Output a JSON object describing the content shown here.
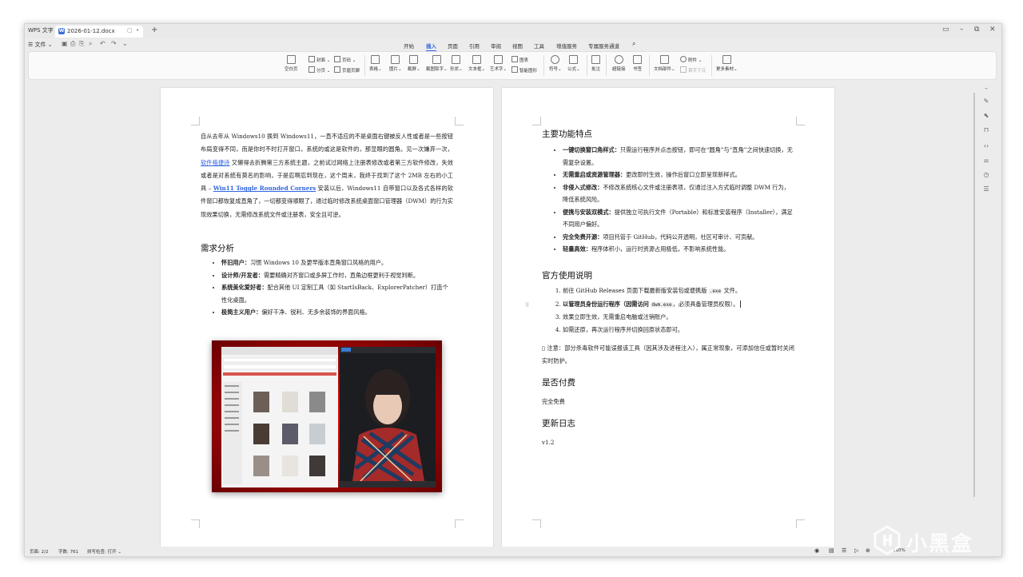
{
  "titlebar": {
    "app_name": "WPS 文字",
    "doc_tab": "2026-01-12.docx",
    "new_tab": "+",
    "win_minimize": "–",
    "win_restore": "⧉",
    "win_close": "✕"
  },
  "menubar": {
    "file_menu": "☰ 文件 ⌄",
    "tabs": [
      "开始",
      "插入",
      "页面",
      "引用",
      "审阅",
      "视图",
      "工具",
      "增值服务",
      "专属服务通道"
    ],
    "active_tab": "插入"
  },
  "ribbon": {
    "blank_page": "空白页",
    "cover": "封面",
    "section_break": "分页",
    "page_number": "页码",
    "header_footer": "页眉页脚",
    "table": "表格",
    "picture": "图片",
    "screenshot": "截屏",
    "screenshot_ocr": "截图取字",
    "shape": "形状",
    "textbox": "文本框",
    "wordart": "艺术字",
    "chart": "图表",
    "smartart": "智能图形",
    "symbol": "符号",
    "formula": "公式",
    "comment": "批注",
    "hyperlink": "超链接",
    "bookmark": "书签",
    "doc_component": "文档部件",
    "attachment": "附件",
    "first_drop": "首字下沉",
    "more_material": "更多素材"
  },
  "page1": {
    "intro_parts": {
      "a": "自从去年从 Windows10 换到 Windows11，一直不适应的不是桌面右键被反人性或者是一些按钮布局变得不同，而是你时不时打开窗口，系统的或这是软件的，那显眼的圆角。见一次嫌弃一次，",
      "link1": "软件格捷诗",
      "b": " 又懒得去折腾第三方系统主题，之前试过网络上注册表修改或者第三方软件修改，失效或者是对系统有莫名的影响，于是忍啊忍到现在，这个周末，我终于找到了这个 2MB 左右的小工具 – ",
      "link2": "Win11 Toggle Rounded Corners",
      "c": " 安装以后，Windows11 自带窗口以及各式各样的软件窗口都恢复成直角了，一切都变得顺眼了，通过临时修改系统桌面窗口管理器（DWM）的行为实现效果切换，无需修改系统文件或注册表，安全且可逆。"
    },
    "needs_heading": "需求分析",
    "needs": [
      {
        "label": "怀旧用户：",
        "text": "习惯 Windows 10 及更早版本直角窗口风格的用户。"
      },
      {
        "label": "设计师/开发者：",
        "text": "需要精确对齐窗口或多屏工作时，直角边框更利于视觉判断。"
      },
      {
        "label": "系统美化爱好者：",
        "text": "配合其他 UI 定制工具（如 StartIsBack、ExplorerPatcher）打造个性化桌面。"
      },
      {
        "label": "极简主义用户：",
        "text": "偏好干净、锐利、无多余装饰的界面风格。"
      }
    ]
  },
  "page2": {
    "features_heading": "主要功能特点",
    "features": [
      {
        "label": "一键切换窗口角样式：",
        "text": "只需运行程序并点击按钮，即可在“圆角”与“直角”之间快速切换，无需复杂设置。"
      },
      {
        "label": "无需重启或资源管理器：",
        "text": "更改即时生效，操作后窗口立即呈现新样式。"
      },
      {
        "label": "非侵入式修改：",
        "text": "不修改系统核心文件或注册表项，仅通过注入方式临时调整 DWM 行为，降低系统风险。"
      },
      {
        "label": "便携与安装双模式：",
        "text": "提供独立可执行文件（Portable）和标准安装程序（Installer），满足不同用户偏好。"
      },
      {
        "label": "完全免费开源：",
        "text": "项目托管于 GitHub，代码公开透明，社区可审计、可贡献。"
      },
      {
        "label": "轻量高效：",
        "text": "程序体积小，运行时资源占用极低，不影响系统性能。"
      }
    ],
    "usage_heading": "官方使用说明",
    "usage": [
      {
        "a": "前往 GitHub Releases 页面下载最新版安装包或便携版 ",
        "code": ".exe",
        "b": " 文件。"
      },
      {
        "a": "以管理员身份运行程序（因需访问 ",
        "code": "dwm.exe",
        "b": "，必须具备管理员权限）。"
      },
      {
        "a": "效果立即生效，无需重启电脑或注销账户。",
        "code": "",
        "b": ""
      },
      {
        "a": "如需还原，再次运行程序并切换回原状态即可。",
        "code": "",
        "b": ""
      }
    ],
    "note": "注意：部分杀毒软件可能误报该工具（因其涉及进程注入），属正常现象，可添加信任或暂时关闭实时防护。",
    "paid_heading": "是否付费",
    "paid_value": "完全免费",
    "changelog_heading": "更新日志",
    "changelog_value": "v1.2"
  },
  "statusbar": {
    "page": "页面: 2/2",
    "words": "字数: 761",
    "spell": "拼写检查: 打开 ⌄",
    "zoom": "110%"
  },
  "watermark": "小黑盒",
  "colors": {
    "accent": "#2f64e0",
    "image_red": "#c40000"
  }
}
